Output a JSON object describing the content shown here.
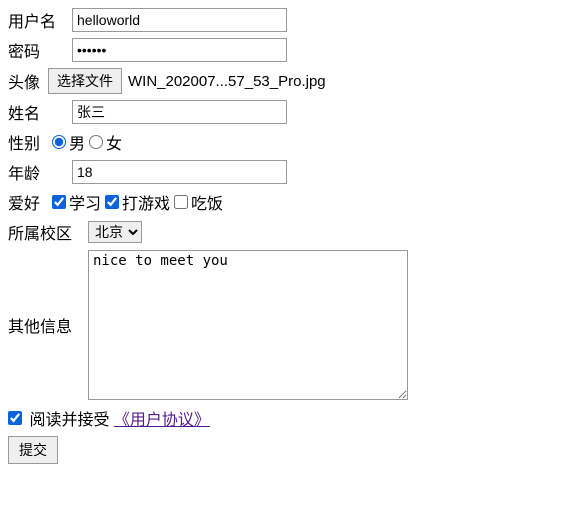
{
  "username": {
    "label": "用户名",
    "value": "helloworld"
  },
  "password": {
    "label": "密码",
    "value": "••••••"
  },
  "avatar": {
    "label": "头像",
    "button": "选择文件",
    "filename": "WIN_202007...57_53_Pro.jpg"
  },
  "name": {
    "label": "姓名",
    "value": "张三"
  },
  "gender": {
    "label": "性别",
    "male": "男",
    "female": "女",
    "value": "male"
  },
  "age": {
    "label": "年龄",
    "value": "18"
  },
  "hobby": {
    "label": "爱好",
    "study": {
      "label": "学习",
      "checked": true
    },
    "game": {
      "label": "打游戏",
      "checked": true
    },
    "eat": {
      "label": "吃饭",
      "checked": false
    }
  },
  "campus": {
    "label": "所属校区",
    "selected": "北京",
    "options": [
      "北京"
    ]
  },
  "other": {
    "label": "其他信息",
    "value": "nice to meet you"
  },
  "agreement": {
    "checked": true,
    "prefix": "阅读并接受",
    "link": "《用户协议》"
  },
  "submit": {
    "label": "提交"
  }
}
